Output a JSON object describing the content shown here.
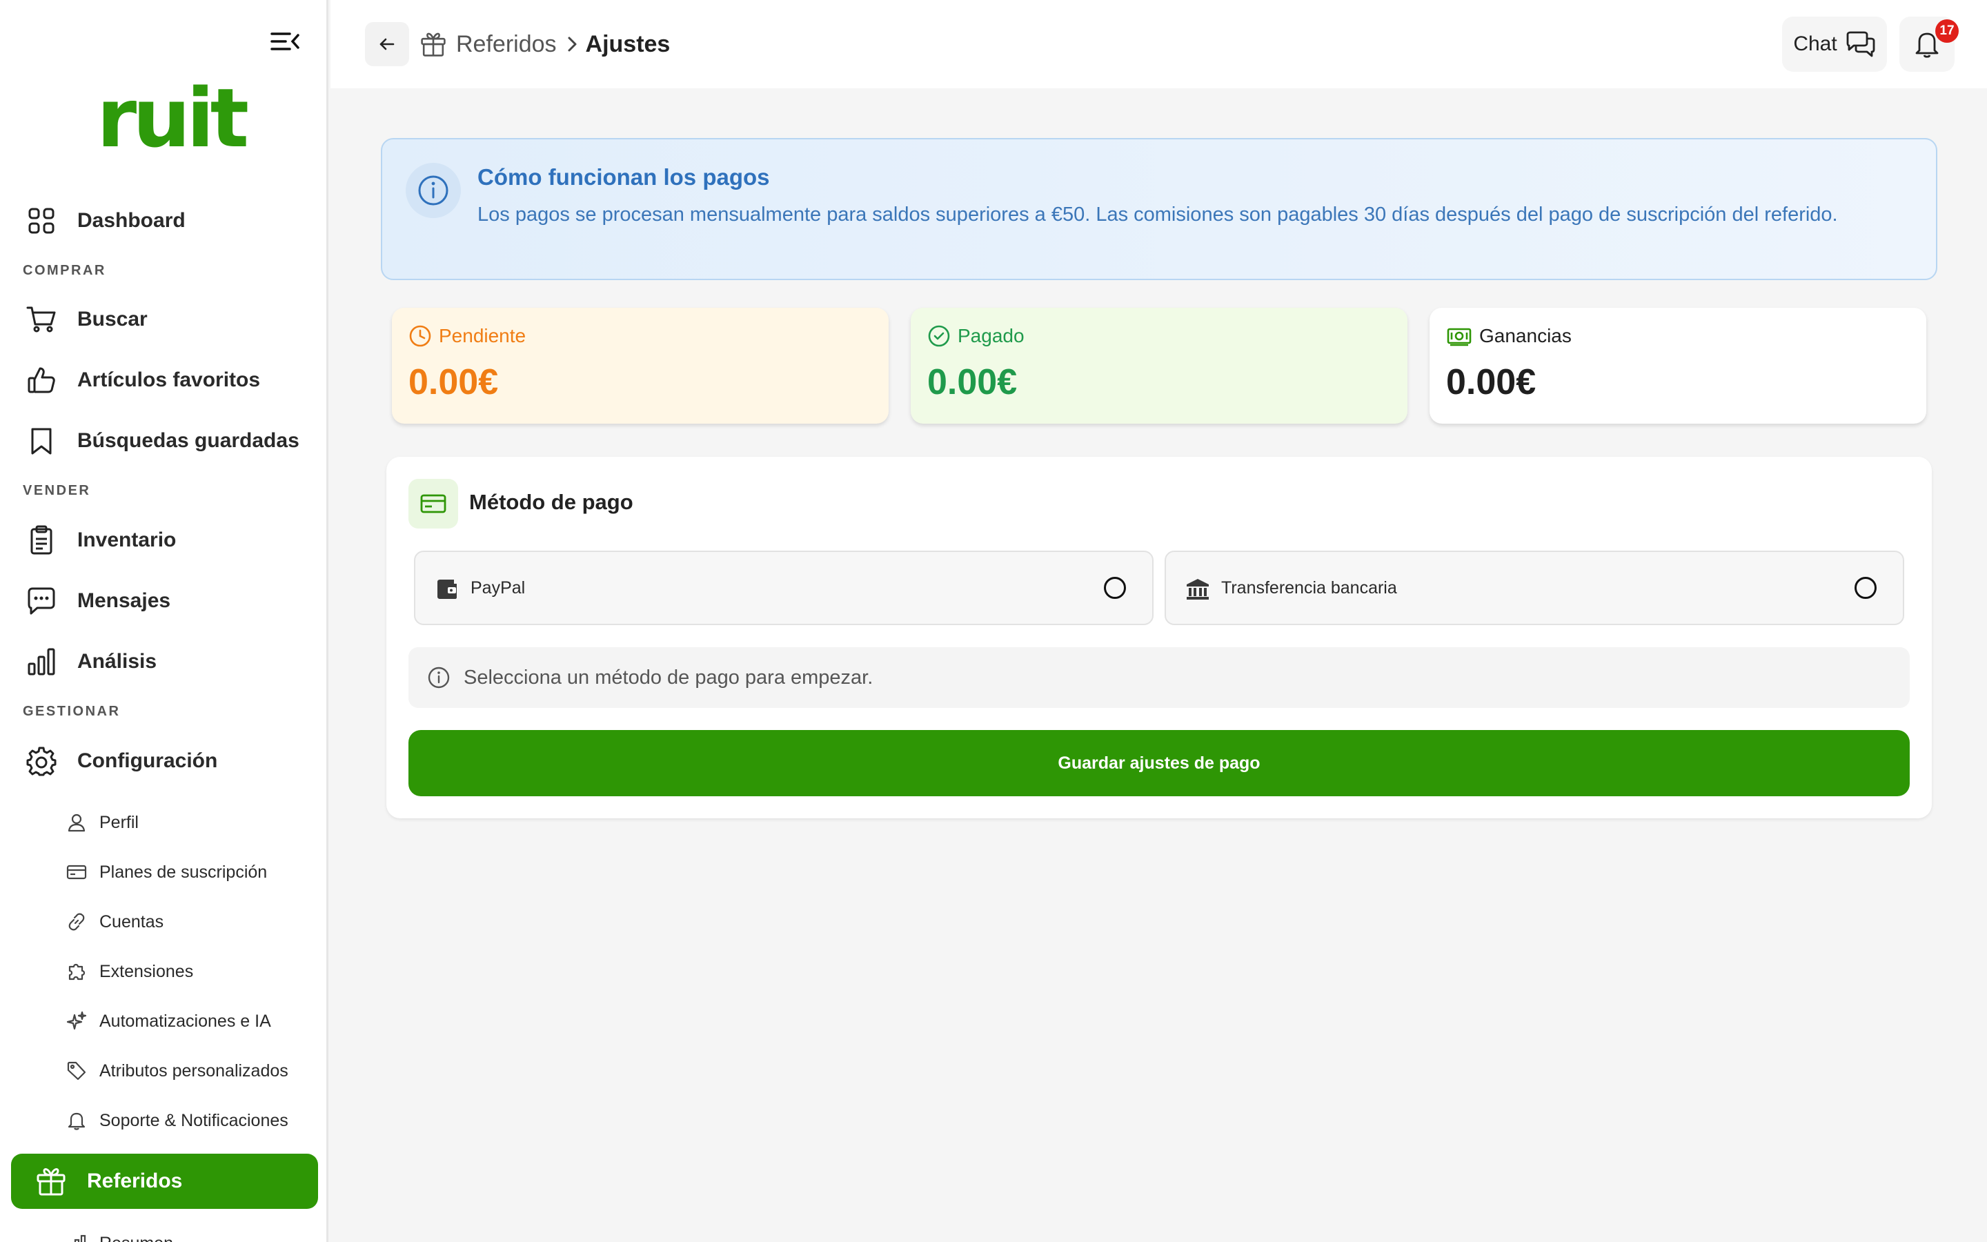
{
  "app": {
    "logo": "ruit"
  },
  "sidebar": {
    "dashboard": "Dashboard",
    "sections": {
      "buy": "COMPRAR",
      "sell": "VENDER",
      "manage": "GESTIONAR"
    },
    "buy_items": {
      "search": "Buscar",
      "favorites": "Artículos favoritos",
      "saved_searches": "Búsquedas guardadas"
    },
    "sell_items": {
      "inventory": "Inventario",
      "messages": "Mensajes",
      "analytics": "Análisis"
    },
    "manage_items": {
      "config": "Configuración"
    },
    "config_sub": {
      "profile": "Perfil",
      "plans": "Planes de suscripción",
      "accounts": "Cuentas",
      "extensions": "Extensiones",
      "automations": "Automatizaciones e IA",
      "attributes": "Atributos personalizados",
      "support": "Soporte & Notificaciones"
    },
    "active": "Referidos",
    "partial": "Resumen"
  },
  "header": {
    "breadcrumb_parent": "Referidos",
    "breadcrumb_current": "Ajustes",
    "chat_label": "Chat",
    "notification_count": "17"
  },
  "info": {
    "title": "Cómo funcionan los pagos",
    "text": "Los pagos se procesan mensualmente para saldos superiores a €50. Las comisiones son pagables 30 días después del pago de suscripción del referido."
  },
  "stats": {
    "pending": {
      "label": "Pendiente",
      "value": "0.00€",
      "color": "#f07d14"
    },
    "paid": {
      "label": "Pagado",
      "value": "0.00€",
      "color": "#1f9a4b"
    },
    "earnings": {
      "label": "Ganancias",
      "value": "0.00€",
      "color": "#1f1f1f"
    }
  },
  "payment": {
    "title": "Método de pago",
    "options": {
      "paypal": "PayPal",
      "bank": "Transferencia bancaria"
    },
    "hint": "Selecciona un método de pago para empezar.",
    "save_label": "Guardar ajustes de pago"
  },
  "colors": {
    "brand": "#2e9605",
    "info_text": "#3b76b8"
  }
}
